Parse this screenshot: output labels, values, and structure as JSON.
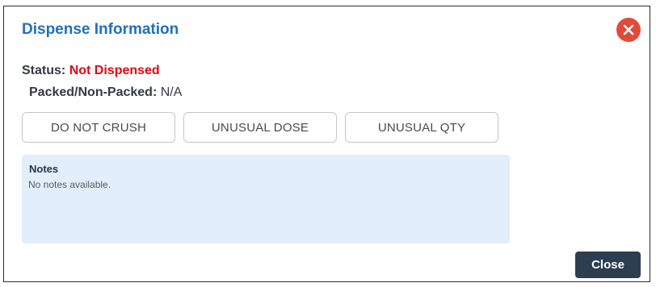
{
  "dialog": {
    "title": "Dispense Information",
    "close_icon": "close-circle-icon",
    "accent_color": "#1f6fc1",
    "close_icon_color": "#e04b3b"
  },
  "status": {
    "label": "Status:",
    "value": "Not Dispensed",
    "value_color": "#e30613"
  },
  "packed": {
    "label": "Packed/Non-Packed:",
    "value": "N/A"
  },
  "flags": [
    {
      "label": "DO NOT CRUSH"
    },
    {
      "label": "UNUSUAL DOSE"
    },
    {
      "label": "UNUSUAL QTY"
    }
  ],
  "notes": {
    "title": "Notes",
    "text": "No notes available.",
    "background_color": "#e3eefc"
  },
  "footer": {
    "close_label": "Close",
    "close_color": "#2c3e50"
  }
}
